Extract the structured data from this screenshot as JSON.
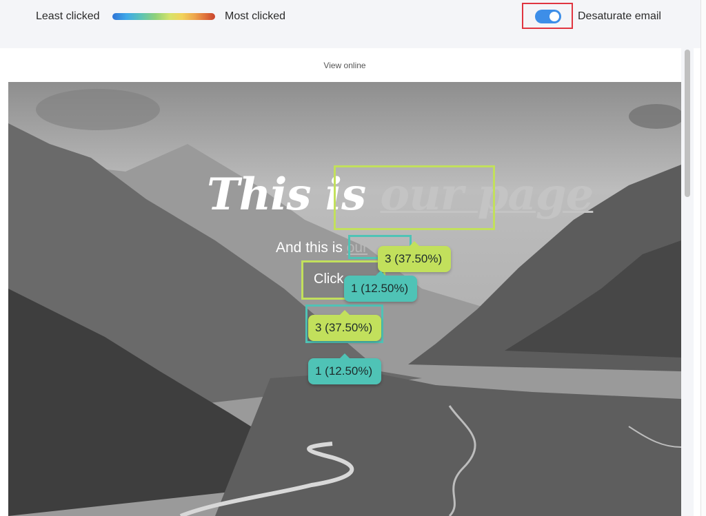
{
  "legend": {
    "least_label": "Least clicked",
    "most_label": "Most clicked"
  },
  "desaturate": {
    "label": "Desaturate email",
    "enabled": true
  },
  "email": {
    "view_online": "View online",
    "headline_prefix": "This is ",
    "headline_link": "our page",
    "subline_prefix": "And this is ",
    "subline_link": "our",
    "cta_label": "Click"
  },
  "click_badges": [
    {
      "label": "3 (37.50%)",
      "color": "green"
    },
    {
      "label": "1 (12.50%)",
      "color": "teal"
    },
    {
      "label": "3 (37.50%)",
      "color": "green"
    },
    {
      "label": "1 (12.50%)",
      "color": "teal"
    }
  ],
  "colors": {
    "toggle_on": "#3d8ee8",
    "highlight_green": "#c2e05c",
    "highlight_teal": "#4fc3b6",
    "annotation_red": "#e0343f"
  }
}
